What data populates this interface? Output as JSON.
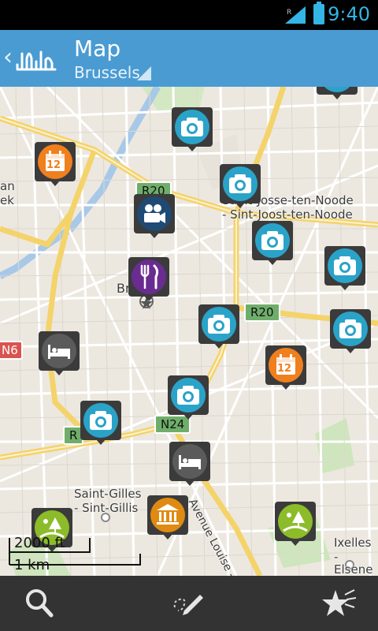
{
  "status_bar": {
    "time": "9:40"
  },
  "header": {
    "title": "Map",
    "city": "Brussels"
  },
  "map": {
    "labels": {
      "saint_josse_1": "Saint-Josse-ten-Noode",
      "saint_josse_2": "- Sint-Joost-ten-Noode",
      "brussels": "Brussels",
      "saint_gilles_1": "Saint-Gilles",
      "saint_gilles_2": "- Sint-Gillis",
      "ixelles_1": "Ixelles",
      "ixelles_2": "- Elsene",
      "avenue_louise": "Avenue Louise - Lo",
      "left_edge_1": "an",
      "left_edge_2": "ek"
    },
    "road_badges": {
      "r20_top": "R20",
      "r20_mid": "R20",
      "n24": "N24",
      "r_left": "R",
      "n6": "N6"
    },
    "scale": {
      "imperial": "2000 ft",
      "metric": "1 km"
    }
  },
  "markers": [
    {
      "type": "photo",
      "color": "#2aa3c9"
    },
    {
      "type": "event",
      "color": "#f07f1e",
      "day": "12"
    },
    {
      "type": "cinema",
      "color": "#1f4a74"
    },
    {
      "type": "restaurant",
      "color": "#6a2c91"
    },
    {
      "type": "hotel",
      "color": "#5b5b5b"
    },
    {
      "type": "museum",
      "color": "#e08a12"
    },
    {
      "type": "park",
      "color": "#8cbc2a"
    }
  ],
  "event_day": "12",
  "colors": {
    "action_bar": "#4a9bd2",
    "bottom_bar": "#333333",
    "status_accent": "#33b5e5"
  }
}
